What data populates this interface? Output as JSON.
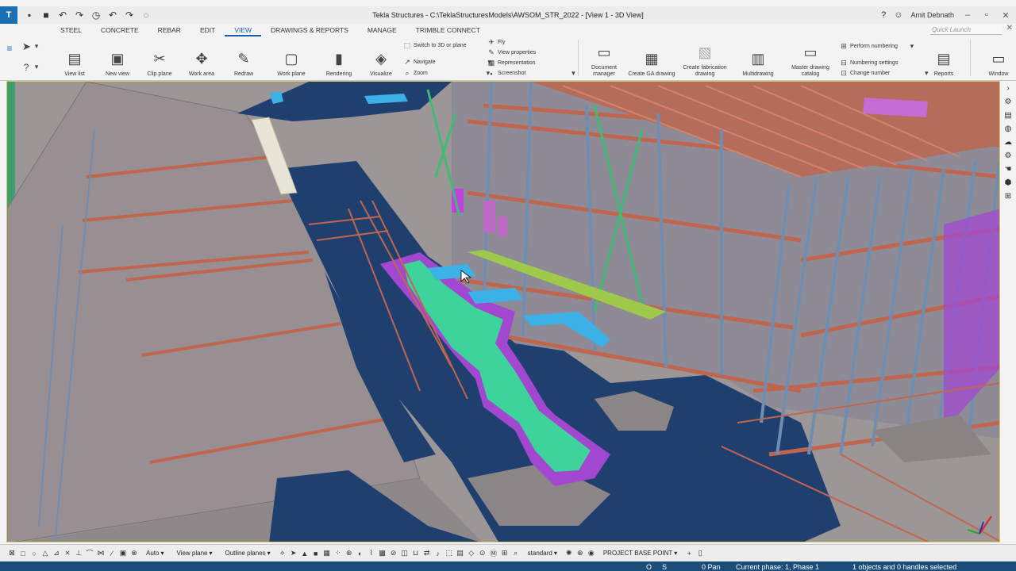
{
  "app": {
    "logo_letter": "T",
    "title": "Tekla Structures - C:\\TeklaStructuresModels\\AWSOM_STR_2022 - [View 1 - 3D View]",
    "user": "Amit Debnath",
    "help_icon": "help-icon",
    "quick_launch_placeholder": "Quick Launch"
  },
  "tabs": [
    "STEEL",
    "CONCRETE",
    "REBAR",
    "EDIT",
    "VIEW",
    "DRAWINGS & REPORTS",
    "MANAGE",
    "TRIMBLE CONNECT"
  ],
  "active_tab": "VIEW",
  "ribbon": {
    "view_list": "View list",
    "new_view": "New view",
    "clip_plane": "Clip plane",
    "work_area": "Work area",
    "redraw": "Redraw",
    "work_plane": "Work plane",
    "rendering": "Rendering",
    "visualize": "Visualize",
    "switch_3d": "Switch to 3D or plane",
    "navigate": "Navigate",
    "zoom": "Zoom",
    "fly": "Fly",
    "view_properties": "View properties",
    "representation": "Representation",
    "screenshot": "Screenshot",
    "document_manager": "Document manager",
    "create_ga_drawing": "Create GA drawing",
    "create_fabrication_drawing": "Create fabrication drawing",
    "multidrawing": "Multidrawing",
    "master_drawing_catalog": "Master drawing catalog",
    "perform_numbering": "Perform numbering",
    "numbering_settings": "Numbering settings",
    "change_number": "Change number",
    "reports": "Reports",
    "window": "Window"
  },
  "bottom_toolbar": {
    "auto": "Auto",
    "view_plane": "View plane",
    "outline_planes": "Outline planes",
    "standard": "standard",
    "project_base_point": "PROJECT BASE POINT"
  },
  "status": {
    "o": "O",
    "s": "S",
    "pan": "0 Pan",
    "phase": "Current phase: 1, Phase 1",
    "selection": "1 objects and 0 handles selected"
  },
  "colors": {
    "statusbar": "#1a4d7a",
    "accent": "#1a5da8",
    "slab_dark": "#1f3f6e",
    "steel_beam": "#c0664f",
    "column_steel": "#6f8db0",
    "bracing_green": "#3ebc73",
    "purple_member": "#a248d0",
    "cyan_duct": "#3bb1e8",
    "wall_grey": "#9b9495"
  }
}
